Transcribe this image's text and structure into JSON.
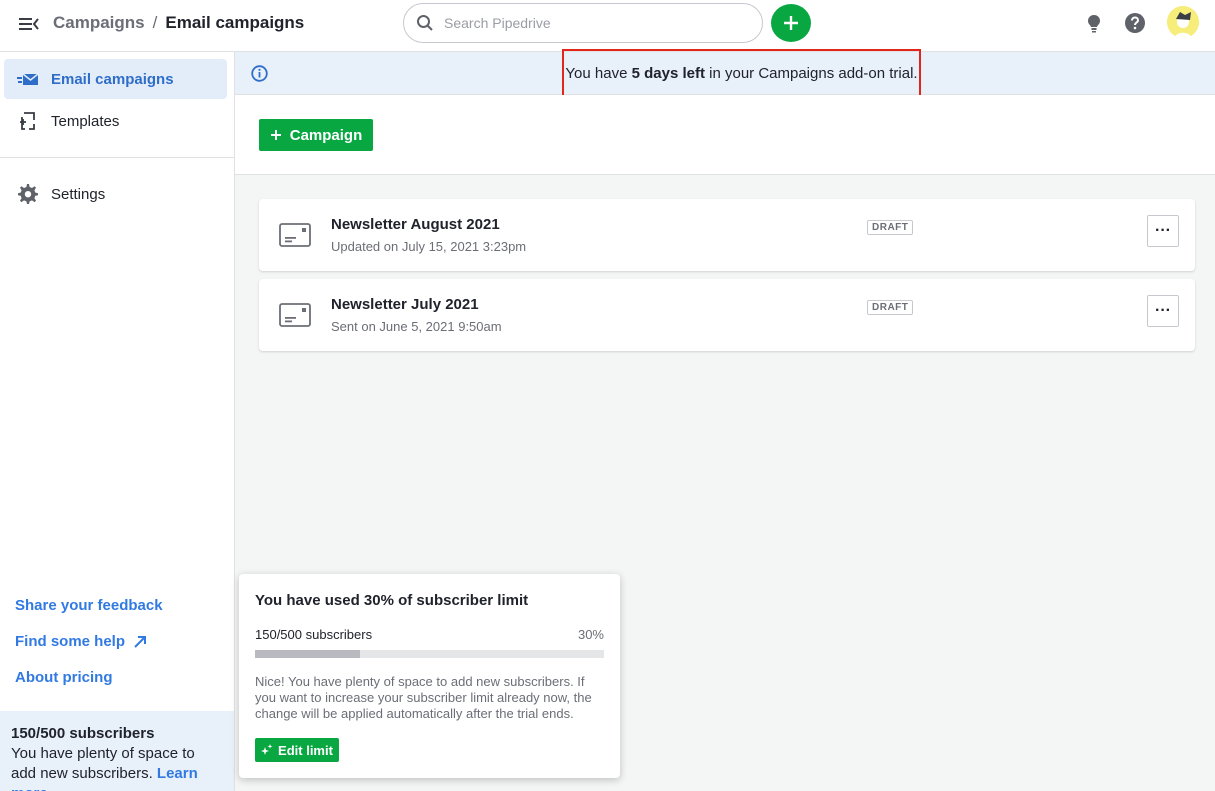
{
  "header": {
    "breadcrumb_parent": "Campaigns",
    "breadcrumb_separator": "/",
    "breadcrumb_current": "Email campaigns",
    "search_placeholder": "Search Pipedrive"
  },
  "sidebar": {
    "items": [
      {
        "label": "Email campaigns",
        "icon": "email-campaigns-icon",
        "active": true
      },
      {
        "label": "Templates",
        "icon": "templates-icon",
        "active": false
      },
      {
        "label": "Settings",
        "icon": "gear-icon",
        "active": false
      }
    ],
    "links": {
      "feedback": "Share your feedback",
      "help": "Find some help",
      "pricing": "About pricing"
    },
    "footer": {
      "count": "150/500 subscribers",
      "text": "You have plenty of space to add new subscribers.",
      "learn_more": "Learn more"
    }
  },
  "banner": {
    "prefix": "You have",
    "highlight": "5 days left",
    "suffix": "in your Campaigns add-on trial."
  },
  "toolbar": {
    "campaign_button": "Campaign"
  },
  "campaigns": [
    {
      "title": "Newsletter August 2021",
      "subtitle": "Updated on July 15, 2021 3:23pm",
      "status": "DRAFT"
    },
    {
      "title": "Newsletter July 2021",
      "subtitle": "Sent on June 5, 2021 9:50am",
      "status": "DRAFT"
    }
  ],
  "popover": {
    "title": "You have used 30% of subscriber limit",
    "count": "150/500 subscribers",
    "percent_label": "30%",
    "usage_fraction": 0.3,
    "message": "Nice! You have plenty of space to add new subscribers. If you want to increase your subscriber limit already now, the change will be applied automatically after the trial ends.",
    "edit_button": "Edit limit"
  },
  "colors": {
    "accent_green": "#08a742",
    "link_blue": "#317ae2",
    "highlight_red": "#e2261b",
    "banner_bg": "#e8f0fa"
  }
}
